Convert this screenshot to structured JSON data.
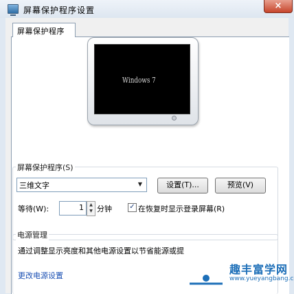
{
  "window": {
    "title": "屏幕保护程序设置",
    "close_label": "×"
  },
  "tab": {
    "label": "屏幕保护程序"
  },
  "preview": {
    "screen_text": "Windows 7"
  },
  "screensaver": {
    "group_label": "屏幕保护程序(S)",
    "selected": "三维文字",
    "settings_button": "设置(T)...",
    "preview_button": "预览(V)",
    "wait_label": "等待(W):",
    "wait_value": "1",
    "minutes_label": "分钟",
    "resume_checked": true,
    "resume_label": "在恢复时显示登录屏幕(R)"
  },
  "power": {
    "group_label": "电源管理",
    "description": "通过调整显示亮度和其他电源设置以节省能源或提",
    "link": "更改电源设置"
  },
  "watermark": {
    "site_name": "趣丰富学网",
    "url": "www.yueyangbang.com"
  }
}
